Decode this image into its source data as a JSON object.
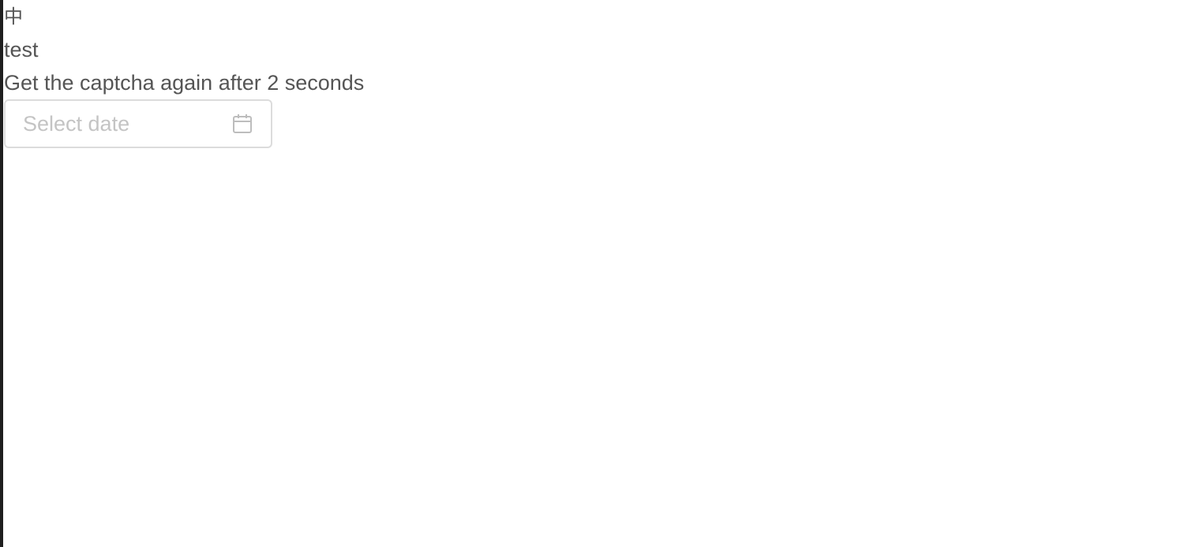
{
  "language_toggle": {
    "label": "中"
  },
  "text_test": "test",
  "captcha_message": "Get the captcha again after 2 seconds",
  "date_picker": {
    "placeholder": "Select date",
    "value": "",
    "icon": "calendar-icon"
  },
  "colors": {
    "text": "#555555",
    "placeholder": "#c4c4c4",
    "border": "#dcdcdc",
    "left_edge": "#1f1f1f"
  }
}
